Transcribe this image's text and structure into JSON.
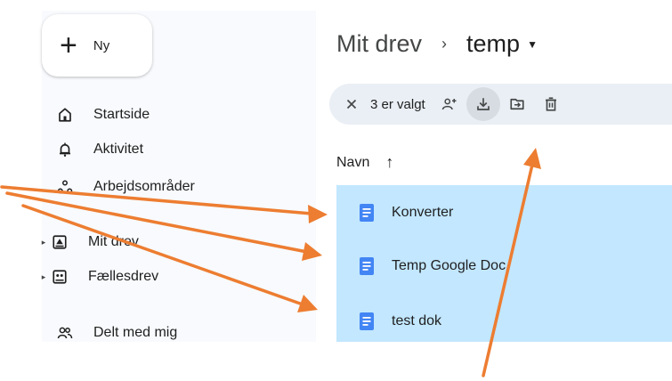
{
  "sidebar": {
    "new_button": {
      "label": "Ny"
    },
    "items": [
      {
        "label": "Startside",
        "icon": "home-icon",
        "has_caret": false
      },
      {
        "label": "Aktivitet",
        "icon": "bell-icon",
        "has_caret": false
      },
      {
        "label": "Arbejdsområder",
        "icon": "workspaces-icon",
        "has_caret": false
      },
      {
        "label": "Mit drev",
        "icon": "my-drive-icon",
        "has_caret": true
      },
      {
        "label": "Fællesdrev",
        "icon": "shared-drives-icon",
        "has_caret": true
      },
      {
        "label": "Delt med mig",
        "icon": "people-icon",
        "has_caret": false
      }
    ]
  },
  "breadcrumb": {
    "root": "Mit drev",
    "separator": "›",
    "current": "temp"
  },
  "toolbar": {
    "selected_count": "3 er valgt",
    "actions": [
      "close-icon",
      "share-icon",
      "download-icon",
      "move-icon",
      "trash-icon"
    ]
  },
  "list": {
    "header": {
      "column": "Navn",
      "sort_arrow": "↑"
    },
    "files": [
      {
        "name": "Konverter",
        "icon": "google-doc-icon"
      },
      {
        "name": "Temp Google Doc",
        "icon": "google-doc-icon"
      },
      {
        "name": "test dok",
        "icon": "google-doc-icon"
      }
    ]
  },
  "colors": {
    "selection": "#c2e7ff",
    "toolbar": "#eaeff5",
    "doc_blue": "#4285f4",
    "annotation_arrow": "#ed7d31"
  }
}
